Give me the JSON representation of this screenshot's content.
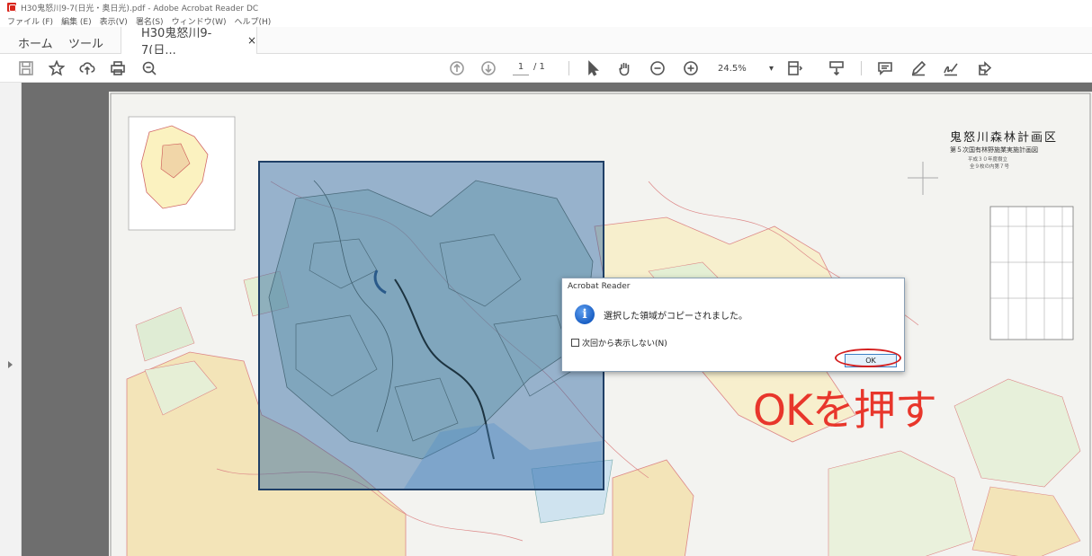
{
  "window": {
    "title": "H30鬼怒川9-7(日光・奥日光).pdf - Adobe Acrobat Reader DC"
  },
  "menu": [
    {
      "label": "ファイル (F)"
    },
    {
      "label": "編集 (E)"
    },
    {
      "label": "表示(V)"
    },
    {
      "label": "署名(S)"
    },
    {
      "label": "ウィンドウ(W)"
    },
    {
      "label": "ヘルプ(H)"
    }
  ],
  "tabs": {
    "home": "ホーム",
    "tools": "ツール",
    "document": "H30鬼怒川9-7(日...",
    "close": "×"
  },
  "toolbar": {
    "page_current": "1",
    "page_total": "/ 1",
    "zoom": "24.5%",
    "zoom_arrow": "▾"
  },
  "map": {
    "title": "鬼怒川森林計画区",
    "subtitle": "第５次国有林野施業実施計画図",
    "line2": "平成３０年度樹立",
    "line3": "全９枚の内第７号"
  },
  "dialog": {
    "title": "Acrobat Reader",
    "message": "選択した領域がコピーされました。",
    "checkbox_label": "次回から表示しない(N)",
    "ok_label": "OK"
  },
  "annotation": {
    "text": "OKを押す",
    "color": "#e8362b"
  },
  "colors": {
    "selection": "#2864a0",
    "accent": "#d41f1f"
  }
}
